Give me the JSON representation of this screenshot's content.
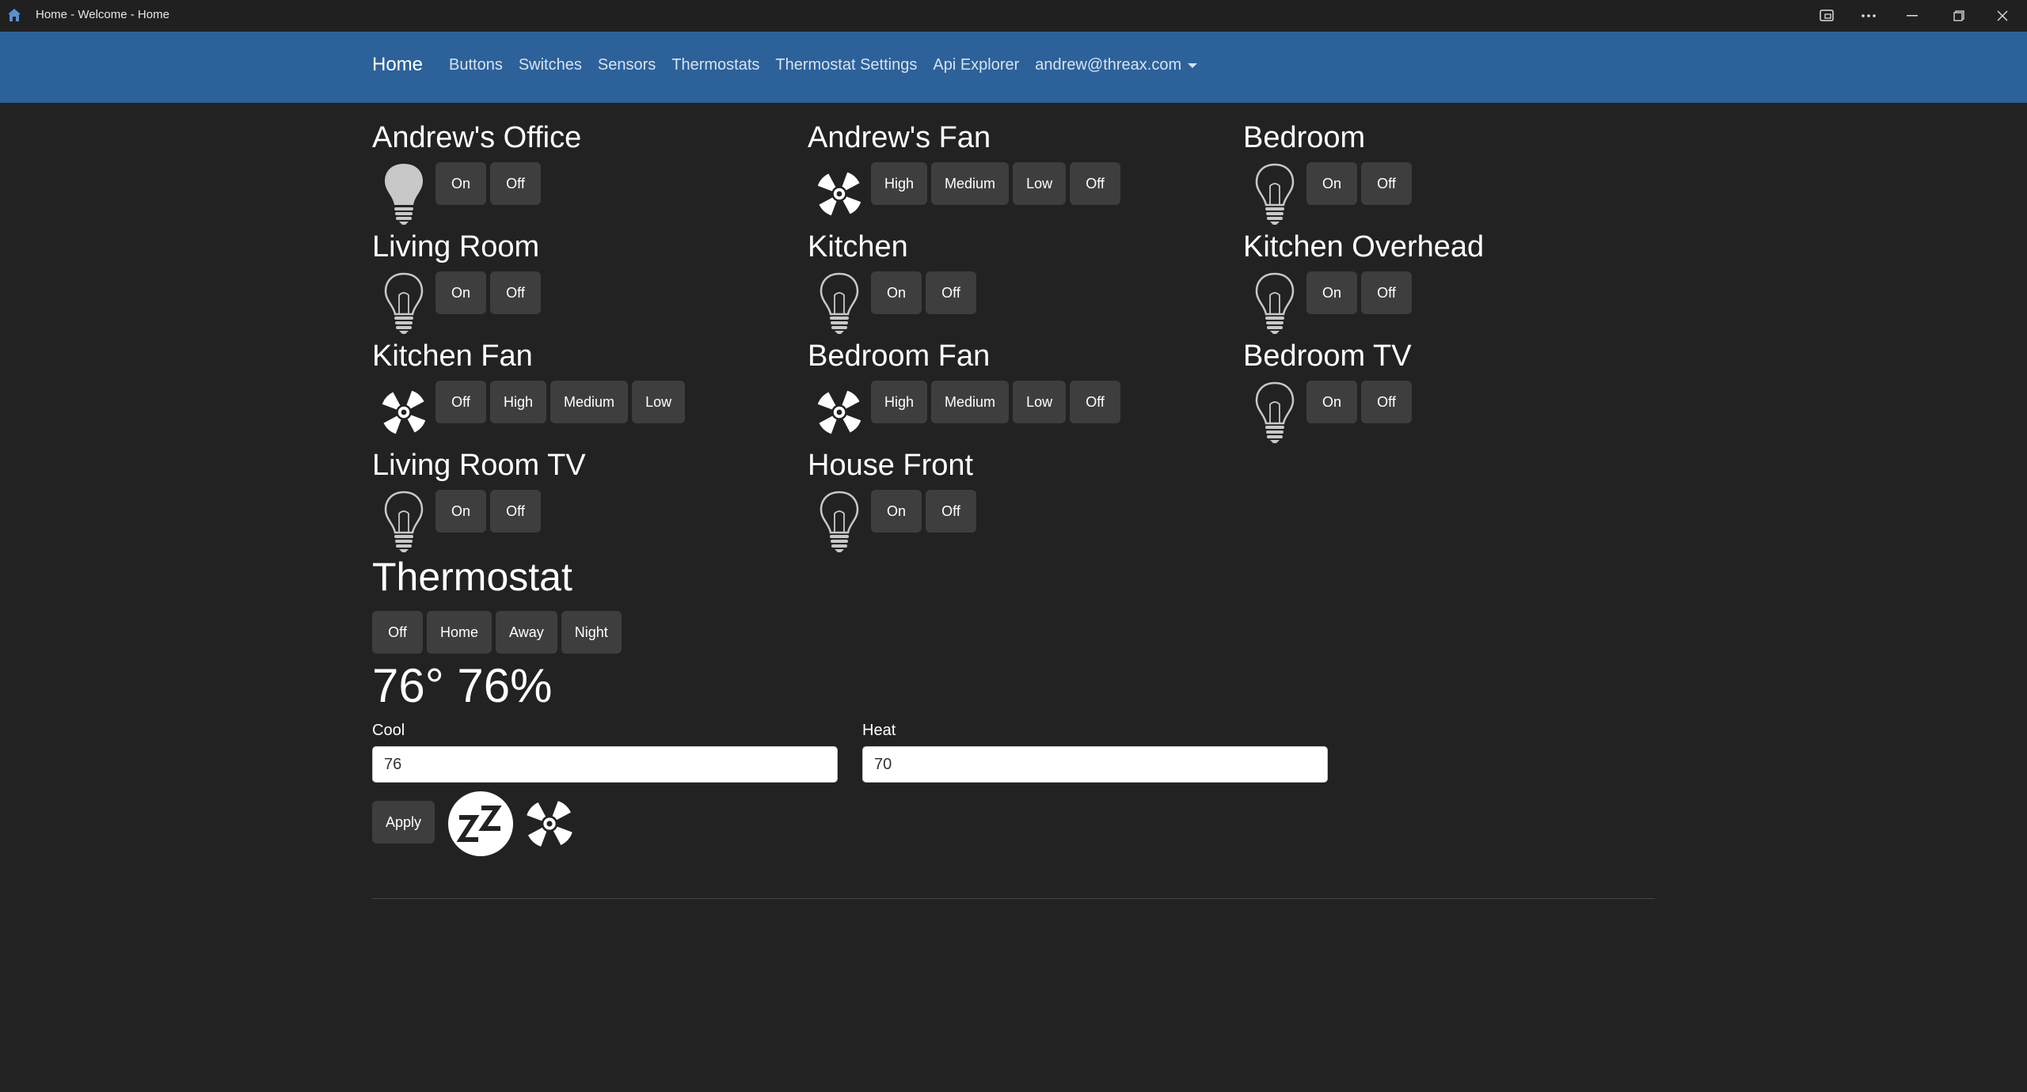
{
  "window": {
    "title": "Home - Welcome - Home"
  },
  "navbar": {
    "brand": "Home",
    "links": [
      "Buttons",
      "Switches",
      "Sensors",
      "Thermostats",
      "Thermostat Settings",
      "Api Explorer"
    ],
    "user": "andrew@threax.com"
  },
  "devices": [
    {
      "name": "Andrew's Office",
      "icon": "bulb-on-icon",
      "buttons": [
        "On",
        "Off"
      ]
    },
    {
      "name": "Andrew's Fan",
      "icon": "fan-icon",
      "buttons": [
        "High",
        "Medium",
        "Low",
        "Off"
      ]
    },
    {
      "name": "Bedroom",
      "icon": "bulb-off-icon",
      "buttons": [
        "On",
        "Off"
      ]
    },
    {
      "name": "Living Room",
      "icon": "bulb-off-icon",
      "buttons": [
        "On",
        "Off"
      ]
    },
    {
      "name": "Kitchen",
      "icon": "bulb-off-icon",
      "buttons": [
        "On",
        "Off"
      ]
    },
    {
      "name": "Kitchen Overhead",
      "icon": "bulb-off-icon",
      "buttons": [
        "On",
        "Off"
      ]
    },
    {
      "name": "Kitchen Fan",
      "icon": "fan-icon",
      "buttons": [
        "Off",
        "High",
        "Medium",
        "Low"
      ]
    },
    {
      "name": "Bedroom Fan",
      "icon": "fan-icon",
      "buttons": [
        "High",
        "Medium",
        "Low",
        "Off"
      ]
    },
    {
      "name": "Bedroom TV",
      "icon": "bulb-off-icon",
      "buttons": [
        "On",
        "Off"
      ]
    },
    {
      "name": "Living Room TV",
      "icon": "bulb-off-icon",
      "buttons": [
        "On",
        "Off"
      ]
    },
    {
      "name": "House Front",
      "icon": "bulb-off-icon",
      "buttons": [
        "On",
        "Off"
      ]
    }
  ],
  "thermostat": {
    "title": "Thermostat",
    "modes": [
      "Off",
      "Home",
      "Away",
      "Night"
    ],
    "reading": "76° 76%",
    "cool_label": "Cool",
    "cool_value": "76",
    "heat_label": "Heat",
    "heat_value": "70",
    "apply_label": "Apply"
  },
  "colors": {
    "background": "#222222",
    "navbar": "#2d6199",
    "button": "#3e3e3e"
  }
}
